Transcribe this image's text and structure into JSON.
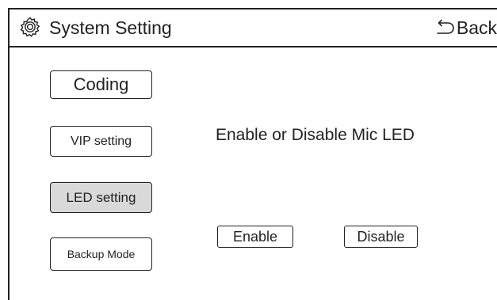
{
  "header": {
    "title": "System Setting",
    "title_icon": "gear-icon",
    "back_label": "Back",
    "back_icon": "return-arrow-icon"
  },
  "sidebar": {
    "items": [
      {
        "label": "Coding",
        "active": false
      },
      {
        "label": "VIP setting",
        "active": false
      },
      {
        "label": "LED setting",
        "active": true
      },
      {
        "label": "Backup Mode",
        "active": false
      }
    ]
  },
  "main": {
    "prompt": "Enable or Disable Mic LED",
    "enable_label": "Enable",
    "disable_label": "Disable"
  },
  "colors": {
    "line": "#222222",
    "active_bg": "#d9d9d9",
    "background": "#ffffff"
  }
}
